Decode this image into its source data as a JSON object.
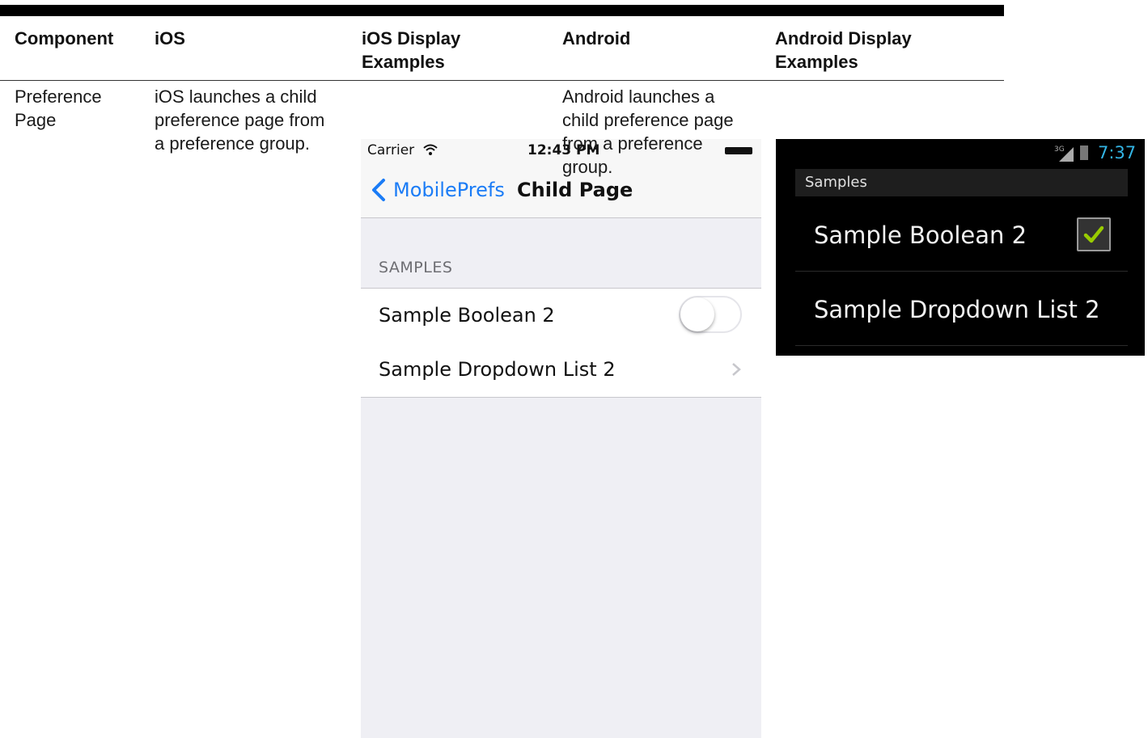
{
  "table": {
    "headers": {
      "component": "Component",
      "ios": "iOS",
      "ios_display_line1": "iOS Display",
      "ios_display_line2": "Examples",
      "android": "Android",
      "android_display_line1": "Android Display",
      "android_display_line2": "Examples"
    },
    "row": {
      "component_line1": "Preference",
      "component_line2": "Page",
      "ios_line1": "iOS launches a child",
      "ios_line2": "preference page from",
      "ios_line3": "a preference group.",
      "android_line1": "Android launches a",
      "android_line2": "child preference page",
      "android_line3": "from a preference",
      "android_line4": "group."
    }
  },
  "ios_example": {
    "carrier": "Carrier",
    "time": "12:43 PM",
    "back_label": "MobilePrefs",
    "title": "Child Page",
    "section": "SAMPLES",
    "rows": [
      {
        "label": "Sample Boolean 2",
        "control": "switch",
        "on": false
      },
      {
        "label": "Sample Dropdown List 2",
        "control": "chevron"
      }
    ],
    "accent": "#1b7cf6"
  },
  "android_example": {
    "network": "3G",
    "time": "7:37",
    "section": "Samples",
    "rows": [
      {
        "label": "Sample Boolean 2",
        "control": "checkbox",
        "checked": true
      },
      {
        "label": "Sample Dropdown List 2"
      }
    ],
    "time_color": "#33b5e5",
    "check_color": "#99cc00"
  }
}
